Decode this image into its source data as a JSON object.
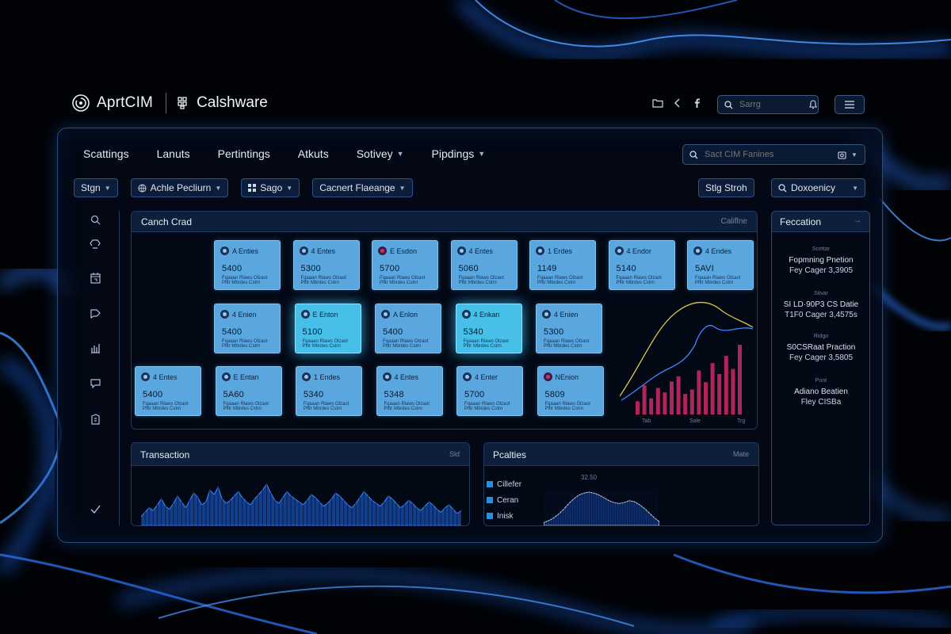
{
  "brand": {
    "logo_name": "ApriCIM",
    "name": "AprtCIM",
    "product": "Calshware"
  },
  "top": {
    "icons": [
      "folder-icon",
      "back-chevron-icon",
      "facebook-icon"
    ],
    "search_placeholder": "Sarrg",
    "search_icon": "search-icon",
    "bell_icon": "bell-icon",
    "menu_icon": "hamburger-menu-icon"
  },
  "nav": {
    "items": [
      {
        "label": "Scattings",
        "dropdown": false
      },
      {
        "label": "Lanuts",
        "dropdown": false
      },
      {
        "label": "Pertintings",
        "dropdown": false
      },
      {
        "label": "Atkuts",
        "dropdown": false
      },
      {
        "label": "Sotivey",
        "dropdown": true
      },
      {
        "label": "Pipdings",
        "dropdown": true
      }
    ],
    "search_placeholder": "Sact CIM Fanines"
  },
  "filters": {
    "left": [
      {
        "label": "Stgn"
      },
      {
        "label": "Achle Pecliurn"
      },
      {
        "label": "Sago"
      },
      {
        "label": "Cacnert Flaeange"
      }
    ],
    "right": [
      {
        "label": "Stlg Stroh"
      },
      {
        "label": "Doxoenicy"
      }
    ]
  },
  "rail_icons": [
    "search-icon",
    "recycle-icon",
    "calendar-icon",
    "chat-icon",
    "bar-chart-icon",
    "message-icon",
    "building-icon",
    "check-icon"
  ],
  "grid": {
    "title": "Canch Crad",
    "link": "Califlne",
    "caption": "Fqaaan Rlaws Olzaot Pfltr Mbrdes Cstrn",
    "rows": [
      [
        {
          "title": "A Enties",
          "value": "5400"
        },
        {
          "title": "4 Entes",
          "value": "5300"
        },
        {
          "title": "E Esdon",
          "value": "5700",
          "flag": true
        },
        {
          "title": "4 Entes",
          "value": "5060"
        },
        {
          "title": "1 Erdes",
          "value": "1149"
        },
        {
          "title": "4 Endor",
          "value": "5140"
        },
        {
          "title": "4 Endes",
          "value": "5AVI"
        }
      ],
      [
        {
          "title": "4 Enien",
          "value": "5400"
        },
        {
          "title": "E Enton",
          "value": "5100",
          "hot": true
        },
        {
          "title": "A Enlon",
          "value": "5400"
        },
        {
          "title": "4 Enkan",
          "value": "5340",
          "hot": true
        },
        {
          "title": "4 Enien",
          "value": "5300"
        }
      ],
      [
        {
          "title": "4 Entes",
          "value": "5400"
        },
        {
          "title": "E Entan",
          "value": "5A60"
        },
        {
          "title": "1 Endes",
          "value": "5340"
        },
        {
          "title": "4 Entes",
          "value": "5348"
        },
        {
          "title": "4 Enter",
          "value": "5700"
        },
        {
          "title": "NEnion",
          "value": "5809",
          "flag": true
        }
      ]
    ]
  },
  "mini_chart": {
    "type": "bar",
    "values": [
      18,
      40,
      22,
      36,
      30,
      45,
      52,
      28,
      34,
      60,
      44,
      70,
      55,
      80,
      62,
      95
    ],
    "x_labels": [
      "Tab",
      "Sale",
      "Trg"
    ],
    "bar_color": "#b0245a",
    "line_colors": [
      "#d7c64a",
      "#3f86ff"
    ]
  },
  "right_panel": {
    "title": "Feccation",
    "items": [
      {
        "tag": "Scettar",
        "line1": "Fopmning Pnetion",
        "line2": "Fey Cager 3,3905"
      },
      {
        "tag": "Sitvar",
        "line1": "SI LD·90P3 CS Datie",
        "line2": "T1F0 Cager 3,4575s"
      },
      {
        "tag": "Ridgo",
        "line1": "S0CSRaat Praction",
        "line2": "Fey Cager 3,5805"
      },
      {
        "tag": "Pont",
        "line1": "Adiano Beatien",
        "line2": "Fley  CISBa"
      }
    ]
  },
  "transaction": {
    "title": "Transaction",
    "link": "Sld",
    "values": [
      6,
      9,
      12,
      10,
      14,
      18,
      13,
      11,
      15,
      20,
      16,
      12,
      17,
      22,
      19,
      14,
      16,
      24,
      21,
      26,
      18,
      15,
      17,
      20,
      23,
      19,
      16,
      14,
      18,
      21,
      24,
      28,
      22,
      17,
      15,
      19,
      23,
      20,
      18,
      16,
      14,
      17,
      21,
      19,
      16,
      13,
      15,
      18,
      22,
      20,
      17,
      14,
      12,
      15,
      19,
      23,
      20,
      17,
      15,
      13,
      16,
      20,
      18,
      15,
      12,
      14,
      17,
      15,
      12,
      10,
      13,
      16,
      14,
      11,
      9,
      12,
      14,
      11,
      8,
      10
    ]
  },
  "facilities": {
    "title": "Pcalties",
    "link": "Mate",
    "legend": [
      "Cillefer",
      "Ceran",
      "Inisk"
    ],
    "label": "32.50",
    "values": [
      3,
      5,
      8,
      12,
      17,
      23,
      28,
      32,
      34,
      35,
      34,
      32,
      29,
      26,
      24,
      23,
      24,
      26,
      25,
      22,
      18,
      13,
      8,
      4
    ]
  },
  "colors": {
    "accent": "#3f86ff",
    "card": "#5aa6de",
    "card_hot": "#47bfe8",
    "panel_border": "#2a4b7c",
    "bar_red": "#b0245a"
  }
}
